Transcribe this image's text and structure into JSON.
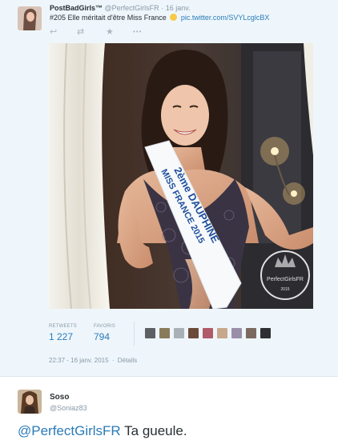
{
  "tweet": {
    "author_name": "PostBadGirls™",
    "author_handle": "@PerfectGirlsFR",
    "date_sep": "·",
    "date": "16 janv.",
    "text": "#205 Elle méritait d'être Miss France",
    "link": "pic.twitter.com/SVYLcglcBX",
    "actions": {
      "reply": "↩",
      "retweet": "⇄",
      "favorite": "★",
      "more": "•••"
    },
    "photo": {
      "sash_text_line1": "2ème DAUPHINE",
      "sash_text_line2": "MISS FRANCE 2015",
      "watermark_text": "PerfectGirlsFR",
      "watermark_year": "2015"
    },
    "stats": {
      "retweets_label": "RETWEETS",
      "retweets_value": "1 227",
      "favorites_label": "FAVORIS",
      "favorites_value": "794"
    },
    "timestamp": "22:37 - 16 janv. 2015",
    "details_sep": "·",
    "details_label": "Détails"
  },
  "reply": {
    "author_name": "Soso",
    "author_handle": "@Soniaz83",
    "mention": "@PerfectGirlsFR",
    "text": " Ta gueule."
  },
  "colors": {
    "link": "#2a7bb8",
    "muted": "#8899a6",
    "tweet_bg": "#eef6fb"
  }
}
